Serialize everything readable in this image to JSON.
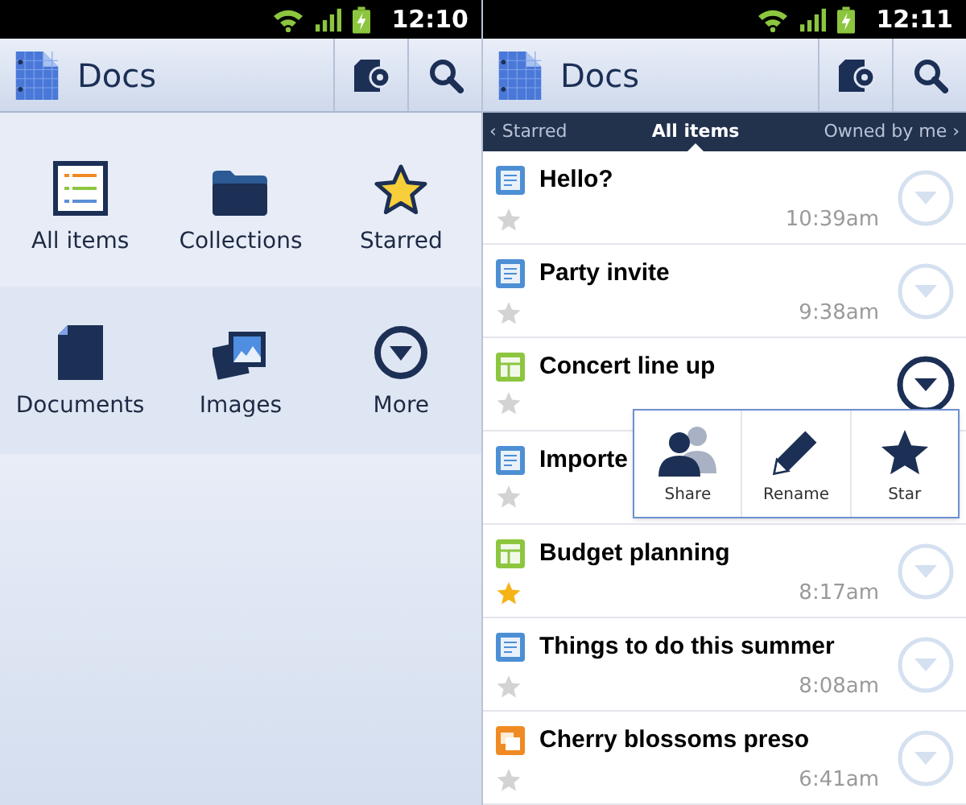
{
  "screens": [
    {
      "status_bar": {
        "time": "12:10"
      },
      "action_bar": {
        "title": "Docs"
      },
      "categories": [
        {
          "label": "All items",
          "kind": "list"
        },
        {
          "label": "Collections",
          "kind": "folder"
        },
        {
          "label": "Starred",
          "kind": "star"
        },
        {
          "label": "Documents",
          "kind": "document"
        },
        {
          "label": "Images",
          "kind": "images"
        },
        {
          "label": "More",
          "kind": "more"
        }
      ]
    },
    {
      "status_bar": {
        "time": "12:11"
      },
      "action_bar": {
        "title": "Docs"
      },
      "tabs": [
        {
          "label": "‹ Starred",
          "selected": false
        },
        {
          "label": "All items",
          "selected": true
        },
        {
          "label": "Owned by me ›",
          "selected": false
        }
      ],
      "documents": [
        {
          "title": "Hello?",
          "kind": "doc",
          "starred": false,
          "time": "10:39am",
          "expanded": false
        },
        {
          "title": "Party invite",
          "kind": "doc",
          "starred": false,
          "time": "9:38am",
          "expanded": false
        },
        {
          "title": "Concert line up",
          "kind": "sheet",
          "starred": false,
          "expanded": true
        },
        {
          "title": "Importe",
          "kind": "doc",
          "starred": false
        },
        {
          "title": "Budget planning",
          "kind": "sheet",
          "starred": true,
          "time": "8:17am",
          "expanded": false
        },
        {
          "title": "Things to do this summer",
          "kind": "doc",
          "starred": false,
          "time": "8:08am",
          "expanded": false
        },
        {
          "title": "Cherry blossoms preso",
          "kind": "slides",
          "starred": false,
          "time": "6:41am",
          "expanded": false
        }
      ],
      "popup_menu": [
        {
          "label": "Share",
          "kind": "share"
        },
        {
          "label": "Rename",
          "kind": "rename"
        },
        {
          "label": "Star",
          "kind": "star"
        }
      ]
    }
  ]
}
